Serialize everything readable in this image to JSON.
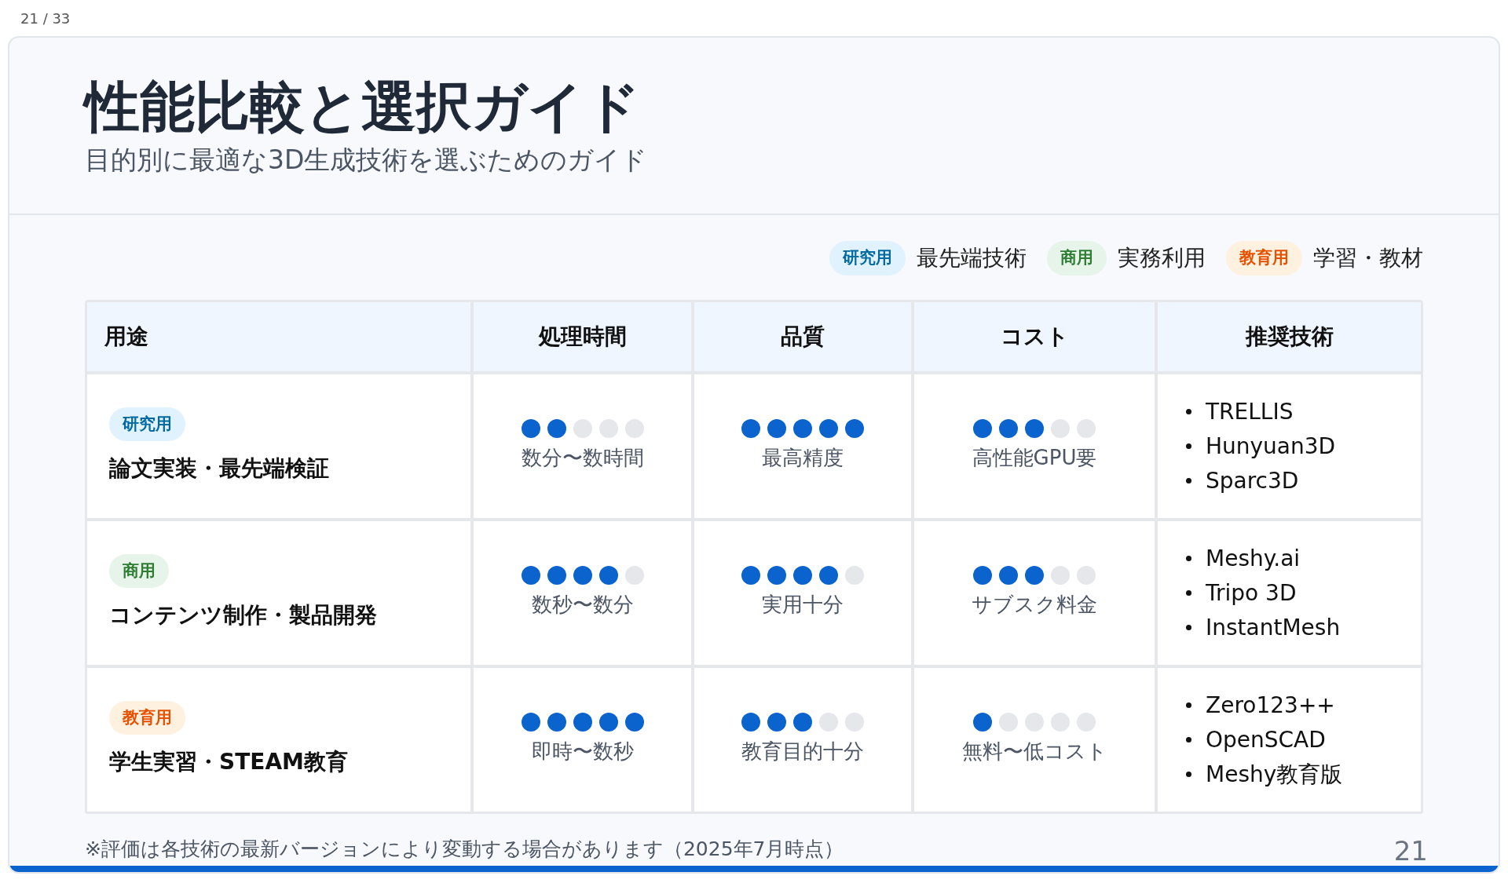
{
  "page_indicator": "21 / 33",
  "slide": {
    "title": "性能比較と選択ガイド",
    "subtitle": "目的別に最適な3D生成技術を選ぶためのガイド",
    "legend": [
      {
        "kind": "research",
        "badge": "研究用",
        "label": "最先端技術"
      },
      {
        "kind": "commercial",
        "badge": "商用",
        "label": "実務利用"
      },
      {
        "kind": "education",
        "badge": "教育用",
        "label": "学習・教材"
      }
    ],
    "table": {
      "columns": [
        "用途",
        "処理時間",
        "品質",
        "コスト",
        "推奨技術"
      ],
      "rows": [
        {
          "kind": "research",
          "badge": "研究用",
          "use": "論文実装・最先端検証",
          "ratings": [
            {
              "stars": 2,
              "label": "数分〜数時間"
            },
            {
              "stars": 5,
              "label": "最高精度"
            },
            {
              "stars": 3,
              "label": "高性能GPU要"
            }
          ],
          "techs": [
            "TRELLIS",
            "Hunyuan3D",
            "Sparc3D"
          ]
        },
        {
          "kind": "commercial",
          "badge": "商用",
          "use": "コンテンツ制作・製品開発",
          "ratings": [
            {
              "stars": 4,
              "label": "数秒〜数分"
            },
            {
              "stars": 4,
              "label": "実用十分"
            },
            {
              "stars": 3,
              "label": "サブスク料金"
            }
          ],
          "techs": [
            "Meshy.ai",
            "Tripo 3D",
            "InstantMesh"
          ]
        },
        {
          "kind": "education",
          "badge": "教育用",
          "use": "学生実習・STEAM教育",
          "ratings": [
            {
              "stars": 5,
              "label": "即時〜数秒"
            },
            {
              "stars": 3,
              "label": "教育目的十分"
            },
            {
              "stars": 1,
              "label": "無料〜低コスト"
            }
          ],
          "techs": [
            "Zero123++",
            "OpenSCAD",
            "Meshy教育版"
          ]
        }
      ]
    },
    "footnote": "※評価は各技術の最新バージョンにより変動する場合があります（2025年7月時点）",
    "page_number": "21"
  }
}
